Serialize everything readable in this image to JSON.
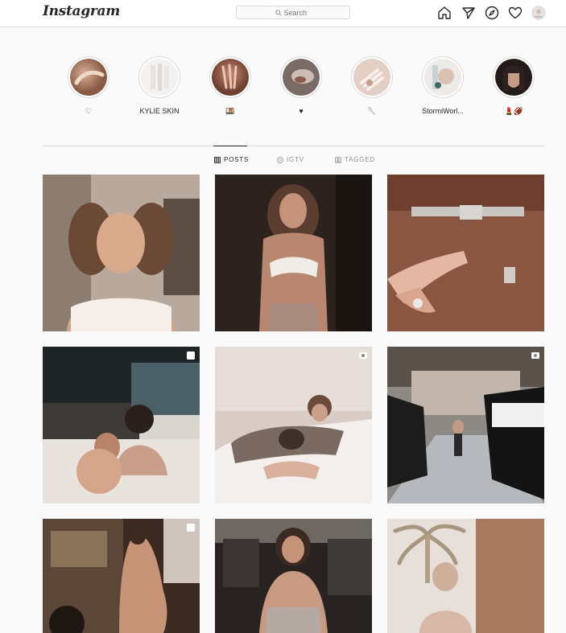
{
  "header": {
    "logo_text": "Instagram",
    "search_placeholder": "Search"
  },
  "nav_icons": [
    "home-icon",
    "direct-icon",
    "explore-icon",
    "activity-heart-icon",
    "profile-avatar"
  ],
  "highlights": [
    {
      "label": "♡",
      "icon": "highlight-cover"
    },
    {
      "label": "KYLIE SKIN",
      "icon": "highlight-cover"
    },
    {
      "label": "🍱",
      "icon": "highlight-cover"
    },
    {
      "label": "♥",
      "icon": "highlight-cover"
    },
    {
      "label": "🥄",
      "icon": "highlight-cover"
    },
    {
      "label": "StormiWorl...",
      "icon": "highlight-cover"
    },
    {
      "label": "💄🏈",
      "icon": "highlight-cover"
    }
  ],
  "tabs": [
    {
      "label": "POSTS",
      "active": true
    },
    {
      "label": "IGTV",
      "active": false
    },
    {
      "label": "TAGGED",
      "active": false
    }
  ],
  "posts": [
    {
      "type": "photo"
    },
    {
      "type": "photo"
    },
    {
      "type": "photo"
    },
    {
      "type": "carousel"
    },
    {
      "type": "video"
    },
    {
      "type": "video"
    },
    {
      "type": "carousel"
    },
    {
      "type": "photo"
    },
    {
      "type": "photo"
    }
  ],
  "colors": {
    "background": "#fafafa",
    "border": "#dbdbdb",
    "text": "#262626",
    "muted": "#8e8e8e"
  }
}
